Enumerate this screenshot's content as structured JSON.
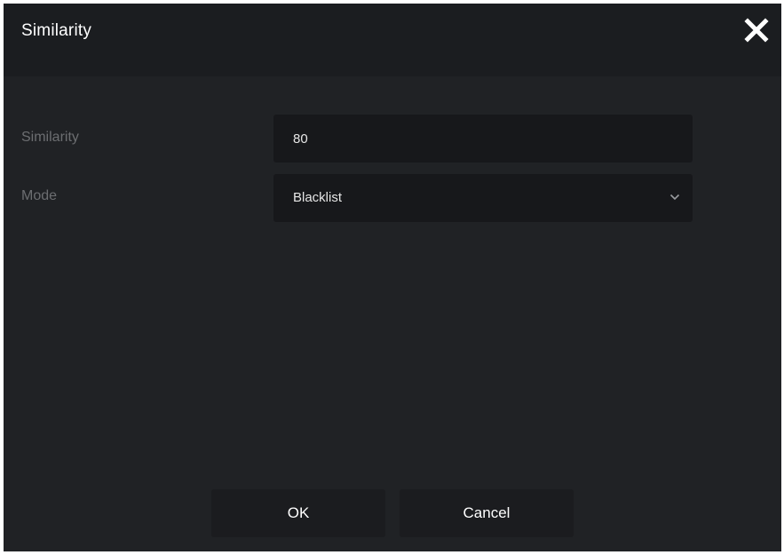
{
  "dialog": {
    "title": "Similarity",
    "close_icon": "close-icon"
  },
  "form": {
    "similarity": {
      "label": "Similarity",
      "value": "80"
    },
    "mode": {
      "label": "Mode",
      "selected": "Blacklist",
      "icon": "chevron-down-icon"
    }
  },
  "buttons": {
    "ok_label": "OK",
    "cancel_label": "Cancel"
  },
  "colors": {
    "background": "#202225",
    "titlebar": "#1b1d20",
    "field": "#17181b",
    "label_text": "#6c6e71",
    "text": "#ffffff"
  }
}
